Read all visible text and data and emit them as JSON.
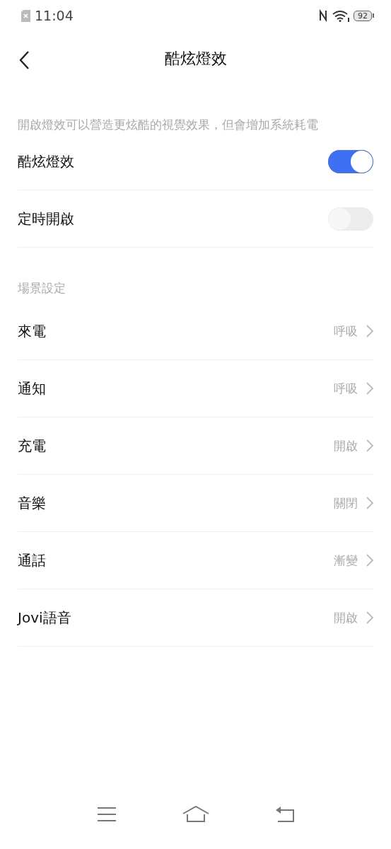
{
  "status_bar": {
    "time": "11:04",
    "battery": "92"
  },
  "header": {
    "title": "酷炫燈效"
  },
  "description": "開啟燈效可以營造更炫酷的視覺效果，但會增加系統耗電",
  "toggles": [
    {
      "label": "酷炫燈效",
      "on": true
    },
    {
      "label": "定時開啟",
      "on": false
    }
  ],
  "section": {
    "title": "場景設定",
    "items": [
      {
        "label": "來電",
        "value": "呼吸"
      },
      {
        "label": "通知",
        "value": "呼吸"
      },
      {
        "label": "充電",
        "value": "開啟"
      },
      {
        "label": "音樂",
        "value": "關閉"
      },
      {
        "label": "通話",
        "value": "漸變"
      },
      {
        "label": "Jovi語音",
        "value": "開啟"
      }
    ]
  }
}
